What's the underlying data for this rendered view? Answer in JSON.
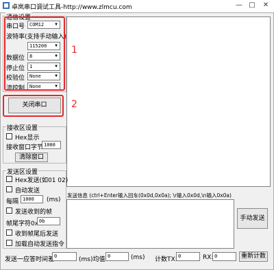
{
  "window": {
    "title": "卓岚串口调试工具-http://www.zlmcu.com"
  },
  "comm": {
    "legend": "通信设置",
    "port_label": "串口号",
    "port_value": "COM12",
    "baud_label": "波特率(支持手动输入)",
    "baud_value": "115200",
    "databits_label": "数据位",
    "databits_value": "8",
    "stopbits_label": "停止位",
    "stopbits_value": "1",
    "parity_label": "校验位",
    "parity_value": "None",
    "flow_label": "流控制",
    "flow_value": "None",
    "close_port_button": "关闭串口"
  },
  "annotations": {
    "label1": "1",
    "label2": "2",
    "color": "#e8262b"
  },
  "receive": {
    "legend": "接收区设置",
    "hex_display_label": "Hex显示",
    "window_bytes_label": "接收窗口字节",
    "window_bytes_value": "1000",
    "clear_button": "清除窗口"
  },
  "send": {
    "legend": "发送区设置",
    "hex_send_label": "Hex发送(如01 02)",
    "auto_send_label": "自动发送",
    "interval_prefix": "每隔",
    "interval_value": "1000",
    "interval_unit": "(ms)",
    "send_on_frame_label": "发送收到的帧",
    "frame_tail_label": "帧尾字符0x",
    "frame_tail_value": "0b",
    "recv_tail_send_label": "收到帧尾后发送",
    "append_auto_label": "加载自动发送指令"
  },
  "send_info": {
    "label": "发送信息 (ctrl+Enter输入回车(0x0d,0x0a); \\r输入0x0d,\\n输入0x0a)",
    "manual_send_button": "手动发送"
  },
  "status": {
    "elapsed_label": "发送一应答时间差",
    "elapsed_value": "0",
    "unit1": "(ms)均值",
    "avg_value": "0",
    "unit2": "(ms)",
    "tx_label": "计数TX:",
    "tx_value": "0",
    "rx_label": "RX:",
    "rx_value": "0",
    "reset_button": "重新计数"
  },
  "colors": {
    "annotation_red": "#e8262b",
    "window_bg": "#f0f0f0"
  }
}
